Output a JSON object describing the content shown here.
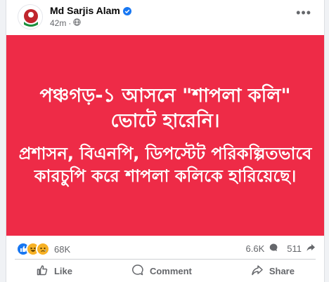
{
  "post": {
    "author": "Md Sarjis Alam",
    "time": "42m",
    "visibility_icon": "globe-icon",
    "image_text_line1": "পঞ্চগড়-১ আসনে \"শাপলা কলি\" ভোটে হারেনি।",
    "image_text_line2": "প্রশাসন, বিএনপি, ডিপস্টেট পরিকল্পিতভাবে কারচুপি করে শাপলা কলিকে হারিয়েছে।",
    "image_bg_color": "#ee2b47"
  },
  "stats": {
    "reaction_icons": [
      "like-icon",
      "haha-icon",
      "sad-icon"
    ],
    "reactions_count": "68K",
    "comments_count": "6.6K",
    "shares_count": "511"
  },
  "actions": {
    "like_label": "Like",
    "comment_label": "Comment",
    "share_label": "Share"
  }
}
